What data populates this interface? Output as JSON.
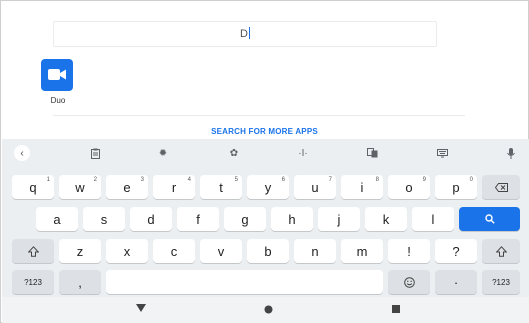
{
  "search": {
    "query": "D"
  },
  "results": [
    {
      "name": "Duo",
      "icon": "video-camera-icon",
      "color": "#1a73e8"
    }
  ],
  "more_apps_label": "SEARCH FOR MORE APPS",
  "keyboard": {
    "toolbar": [
      "back-chevron-icon",
      "clipboard-icon",
      "settings-icon",
      "palette-icon",
      "cursor-move-icon",
      "translate-icon",
      "keyboard-icon",
      "microphone-icon"
    ],
    "row1": [
      {
        "k": "q",
        "n": "1"
      },
      {
        "k": "w",
        "n": "2"
      },
      {
        "k": "e",
        "n": "3"
      },
      {
        "k": "r",
        "n": "4"
      },
      {
        "k": "t",
        "n": "5"
      },
      {
        "k": "y",
        "n": "6"
      },
      {
        "k": "u",
        "n": "7"
      },
      {
        "k": "i",
        "n": "8"
      },
      {
        "k": "o",
        "n": "9"
      },
      {
        "k": "p",
        "n": "0"
      }
    ],
    "row2": [
      "a",
      "s",
      "d",
      "f",
      "g",
      "h",
      "j",
      "k",
      "l"
    ],
    "row3": [
      "z",
      "x",
      "c",
      "v",
      "b",
      "n",
      "m",
      "!",
      "?"
    ],
    "symbols_label": "?123",
    "comma": ",",
    "period": "·",
    "accent_color": "#1a73e8"
  }
}
